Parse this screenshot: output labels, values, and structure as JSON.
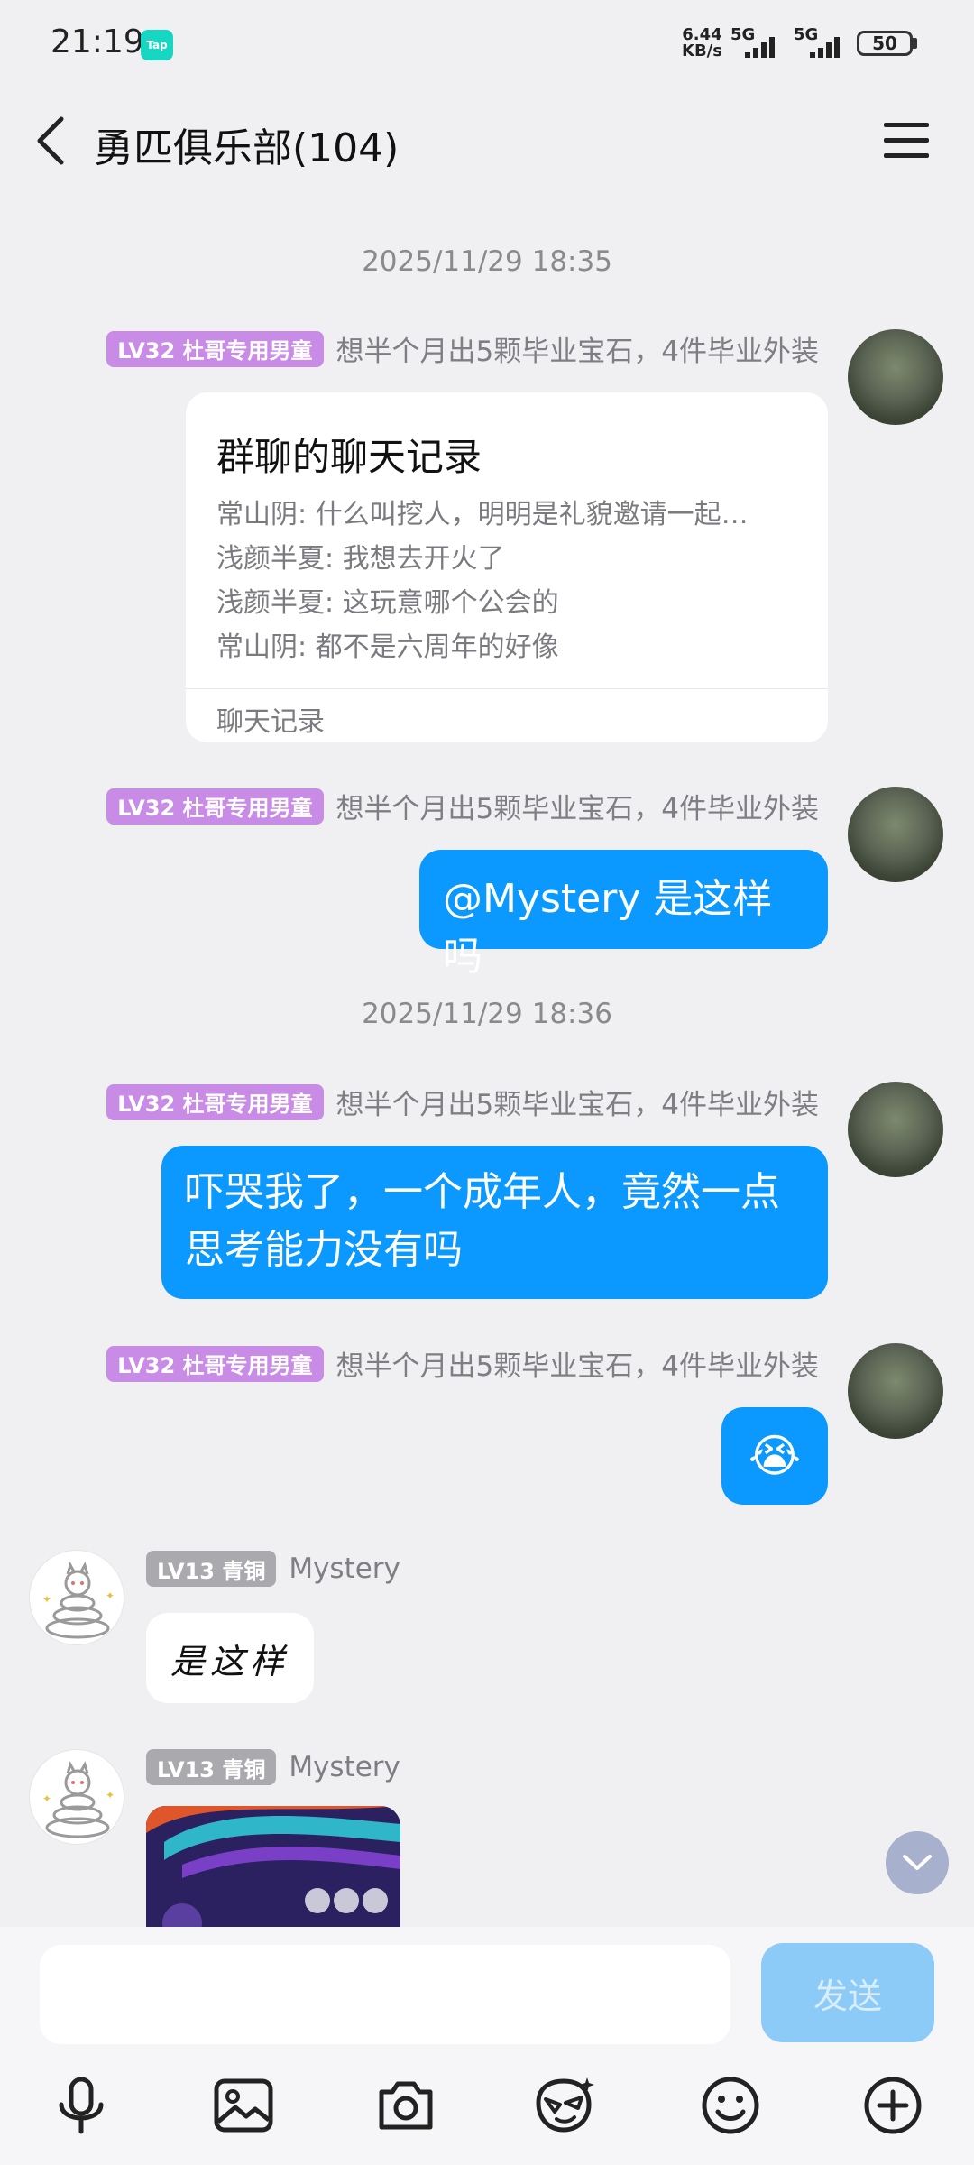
{
  "status_bar": {
    "time": "21:19",
    "app_badge": "Tap",
    "net_speed_value": "6.44",
    "net_speed_unit": "KB/s",
    "signal_1": "5G",
    "signal_2": "5G",
    "battery": "50"
  },
  "header": {
    "title": "勇匹俱乐部(104)"
  },
  "messages": {
    "ts1": "2025/11/29 18:35",
    "ts2": "2025/11/29 18:36",
    "self_badge": "LV32 杜哥专用男童",
    "self_name": "想半个月出5颗毕业宝石，4件毕业外装",
    "card": {
      "title": "群聊的聊天记录",
      "lines": [
        "常山阴: 什么叫挖人，明明是礼貌邀请一起…",
        "浅颜半夏: 我想去开火了",
        "浅颜半夏: 这玩意哪个公会的",
        "常山阴: 都不是六周年的好像"
      ],
      "footer": "聊天记录"
    },
    "msg2": "@Mystery 是这样吗",
    "msg3_line1": "吓哭我了，一个成年人，竟然一点",
    "msg3_line2": "思考能力没有吗",
    "msg4_emoji": "😭",
    "other_badge": "LV13 青铜",
    "other_name": "Mystery",
    "msg5": "是这样"
  },
  "input": {
    "placeholder": "",
    "send_label": "发送"
  },
  "icons": {
    "tools": [
      "microphone-icon",
      "image-icon",
      "camera-icon",
      "sticker-icon",
      "emoji-icon",
      "plus-icon"
    ]
  },
  "colors": {
    "bubble_blue": "#0b99ff",
    "badge_purple": "#c98ce6",
    "badge_gray": "#a9a9ae",
    "send_disabled": "#8ccaf8"
  }
}
